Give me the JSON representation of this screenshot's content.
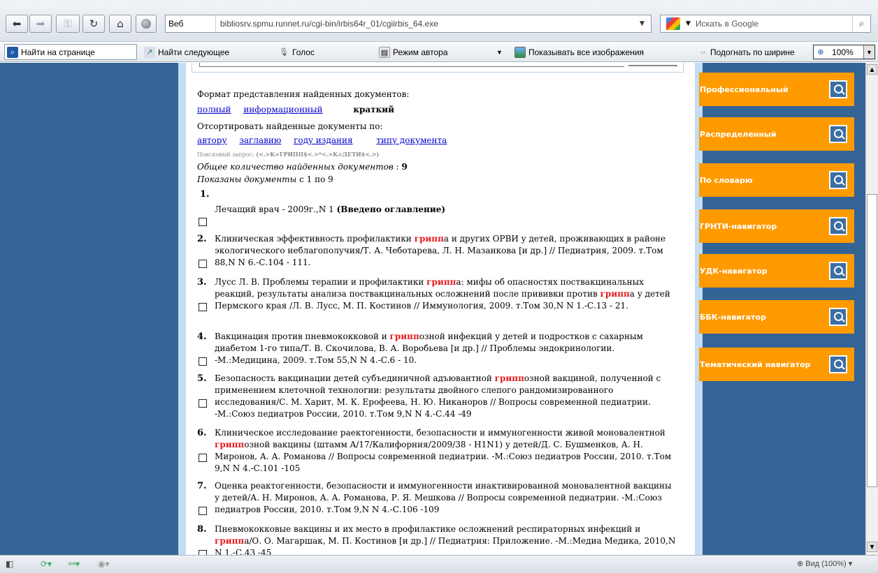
{
  "nav": {
    "web_label": "Веб",
    "url": "bibliosrv.spmu.runnet.ru/cgi-bin/irbis64r_01/cgiirbis_64.exe",
    "search_placeholder": "Искать в Google"
  },
  "toolbar": {
    "find_on_page": "Найти на странице",
    "find_next": "Найти следующее",
    "voice": "Голос",
    "author_mode": "Режим автора",
    "show_images": "Показывать все изображения",
    "fit_width": "Подогнать по ширине",
    "zoom": "100%"
  },
  "main": {
    "format_label": "Формат представления найденных документов:",
    "formats": [
      "полный",
      "информационный"
    ],
    "format_selected": "краткий",
    "sort_label": "Отсортировать найденные документы по:",
    "sort_options": [
      "автору",
      "заглавию",
      "году издания",
      "типу документа"
    ],
    "query_label": "Поисковый запрос:",
    "query_value": "(<.>K=ГРИПП$<.>*<.>K=ДЕТИ$<.>)",
    "total_label": "Общее количество найденных документов",
    "total_value": "9",
    "shown_label": "Показаны документы",
    "shown_value": "с 1 по 9"
  },
  "documents": [
    {
      "num": "1.",
      "text": "Лечащий врач - 2009г.,N 1",
      "bold_suffix": "(Введено оглавление)"
    },
    {
      "num": "2.",
      "text": "Клиническая эффективность профилактики <b>гриппа</b> и других ОРВИ у детей, проживающих в районе экологического неблагополучия/Т. А. Чеботарева, Л. Н. Мазанкова [и др.] // Педиатрия, 2009. т.Том 88,N N 6.-С.104 - 111."
    },
    {
      "num": "3.",
      "text": "Лусс Л. В. Проблемы терапии и профилактики гриппа: мифы об опасностях поствакцинальных реакций, результаты анализа поствакцинальных осложнений после прививки против гриппа у детей Пермского края /Л. В. Лусс, М. П. Костинов // Иммунология, 2009. т.Том 30,N N 1.-С.13 - 21."
    },
    {
      "num": "4.",
      "text": "Вакцинация против пневмококковой и гриппозной инфекций у детей и подростков с сахарным диабетом 1-го типа/Т. В. Скочилова, В. А. Воробьева [и др.] // Проблемы эндокринологии. -М.:Медицина, 2009. т.Том 55,N N 4.-С.6 - 10."
    },
    {
      "num": "5.",
      "text": "Безопасность вакцинации детей субъединичной адъювантной гриппозной вакциной, полученной с применением клеточной технологии: результаты двойного слепого рандомизированного исследования/С. М. Харит, М. К. Ерофеева, Н. Ю. Никаноров // Вопросы современной педиатрии. -М.:Союз педиатров России, 2010. т.Том 9,N N 4.-С.44 -49"
    },
    {
      "num": "6.",
      "text": "Клиническое исследование раектогенности, безопасности и иммуногенности живой моновалентной гриппозной вакцины (штамм A/17/Калифорния/2009/38 - H1N1) у детей/Д. С. Бушменков, А. Н. Миронов, А. А. Романова // Вопросы современной педиатрии. -М.:Союз педиатров России, 2010. т.Том 9,N N 4.-С.101 -105"
    },
    {
      "num": "7.",
      "text": "Оценка реактогенности, безопасности и иммуногенности инактивированной моновалентной вакцины у детей/А. Н. Миронов, А. А. Романова, Р. Я. Мешкова // Вопросы современной педиатрии. -М.:Союз педиатров России, 2010. т.Том 9,N N 4.-С.106 -109"
    },
    {
      "num": "8.",
      "text": "Пневмококковые вакцины и их место в профилактике осложнений респираторных инфекций и гриппа/О. О. Магаршак, М. П. Костинов [и др.] // Педиатрия: Приложение. -М.:Медиа Медика, 2010,N N 1.-С.43 -45"
    }
  ],
  "highlight_word": "грипп",
  "navigators": [
    "Профессиональный",
    "Распределенный",
    "По словарю",
    "ГРНТИ-навигатор",
    "УДК-навигатор",
    "ББК-навигатор",
    "Тематический навигатор"
  ],
  "status": {
    "zoom": "Вид (100%)"
  },
  "colors": {
    "side_blue": "#346496",
    "strip": "#c3ddf3",
    "orange": "#ff9a00",
    "highlight": "#e8191c",
    "link": "#0000cc"
  },
  "icons": [
    "back-arrow-icon",
    "forward-arrow-icon",
    "key-icon",
    "refresh-icon",
    "home-icon",
    "globe-icon",
    "google-icon",
    "search-icon",
    "magnifier-icon"
  ]
}
